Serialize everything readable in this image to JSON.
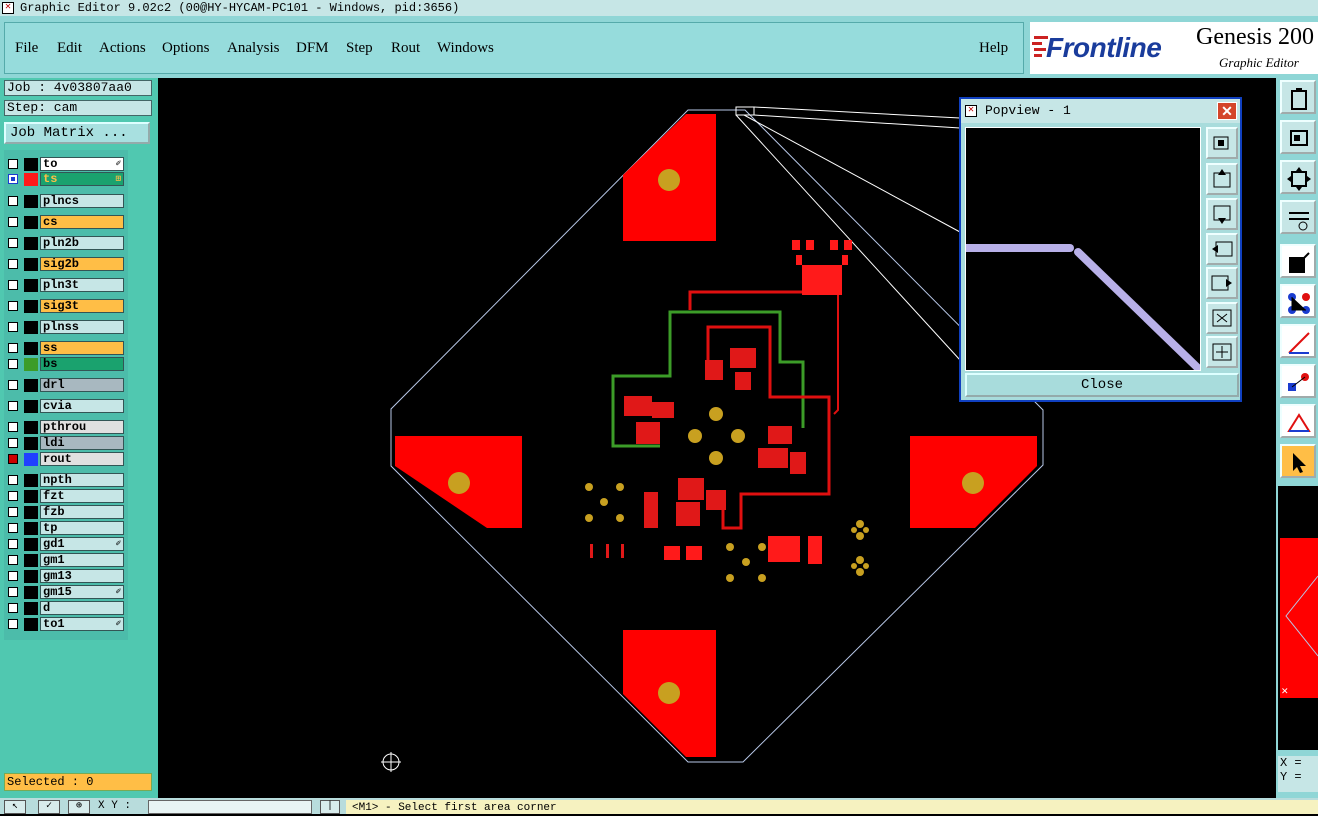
{
  "window": {
    "title": "Graphic Editor 9.02c2 (00@HY-HYCAM-PC101 - Windows, pid:3656)"
  },
  "menu": {
    "file": "File",
    "edit": "Edit",
    "actions": "Actions",
    "options": "Options",
    "analysis": "Analysis",
    "dfm": "DFM",
    "step": "Step",
    "rout": "Rout",
    "windows": "Windows",
    "help": "Help"
  },
  "logo": {
    "brand": "Frontline",
    "product": "Genesis 200",
    "subtitle": "Graphic Editor"
  },
  "job": {
    "label": "Job : 4v03807aa0",
    "step": "Step: cam",
    "matrix_button": "Job Matrix ..."
  },
  "layers": [
    {
      "name": "to",
      "color": "#ffffff",
      "swatch": "#000000",
      "mark": "✐"
    },
    {
      "name": "ts",
      "color": "#1aa26e",
      "swatch": "#ff1a1a",
      "mark": "⊞",
      "active": true
    },
    {
      "name": "plncs",
      "color": "#c6e6e6",
      "swatch": ""
    },
    {
      "name": "cs",
      "color": "#ffbe46",
      "swatch": ""
    },
    {
      "name": "pln2b",
      "color": "#c6e6e6",
      "swatch": ""
    },
    {
      "name": "sig2b",
      "color": "#ffbe46",
      "swatch": ""
    },
    {
      "name": "pln3t",
      "color": "#c6e6e6",
      "swatch": ""
    },
    {
      "name": "sig3t",
      "color": "#ffbe46",
      "swatch": ""
    },
    {
      "name": "plnss",
      "color": "#c6e6e6",
      "swatch": ""
    },
    {
      "name": "ss",
      "color": "#ffbe46",
      "swatch": ""
    },
    {
      "name": "bs",
      "color": "#1aa26e",
      "swatch": "#3c9c28"
    },
    {
      "name": "drl",
      "color": "#a8b8c0",
      "swatch": ""
    },
    {
      "name": "cvia",
      "color": "#c6e6e6",
      "swatch": ""
    },
    {
      "name": "pthrou",
      "color": "#e0e0e0",
      "swatch": ""
    },
    {
      "name": "ldi",
      "color": "#a8b8c0",
      "swatch": ""
    },
    {
      "name": "rout",
      "color": "#e0e0e0",
      "swatch": "#2040ff",
      "mark_color": "#c00"
    },
    {
      "name": "npth",
      "color": "#c6e6e6",
      "swatch": ""
    },
    {
      "name": "fzt",
      "color": "#c6e6e6",
      "swatch": ""
    },
    {
      "name": "fzb",
      "color": "#c6e6e6",
      "swatch": ""
    },
    {
      "name": "tp",
      "color": "#c6e6e6",
      "swatch": ""
    },
    {
      "name": "gd1",
      "color": "#c6e6e6",
      "swatch": "",
      "mark": "✐"
    },
    {
      "name": "gm1",
      "color": "#c6e6e6",
      "swatch": ""
    },
    {
      "name": "gm13",
      "color": "#c6e6e6",
      "swatch": ""
    },
    {
      "name": "gm15",
      "color": "#c6e6e6",
      "swatch": "",
      "mark": "✐"
    },
    {
      "name": "d",
      "color": "#c6e6e6",
      "swatch": ""
    },
    {
      "name": "to1",
      "color": "#c6e6e6",
      "swatch": "",
      "mark": "✐"
    }
  ],
  "selected": "Selected : 0",
  "status": {
    "xy_label": "X Y :",
    "xy_value": "",
    "message": "<M1> - Select first area corner"
  },
  "popview": {
    "title": "Popview - 1",
    "close_label": "Close"
  },
  "readout": {
    "x": "X =",
    "y": "Y ="
  },
  "colors": {
    "pad_red": "#ff0000",
    "trace_red": "#e01010",
    "trace_green": "#3c9c28",
    "drill_gold": "#c8a020",
    "outline": "#b8c8e8",
    "panel_teal": "#50c8b0"
  }
}
